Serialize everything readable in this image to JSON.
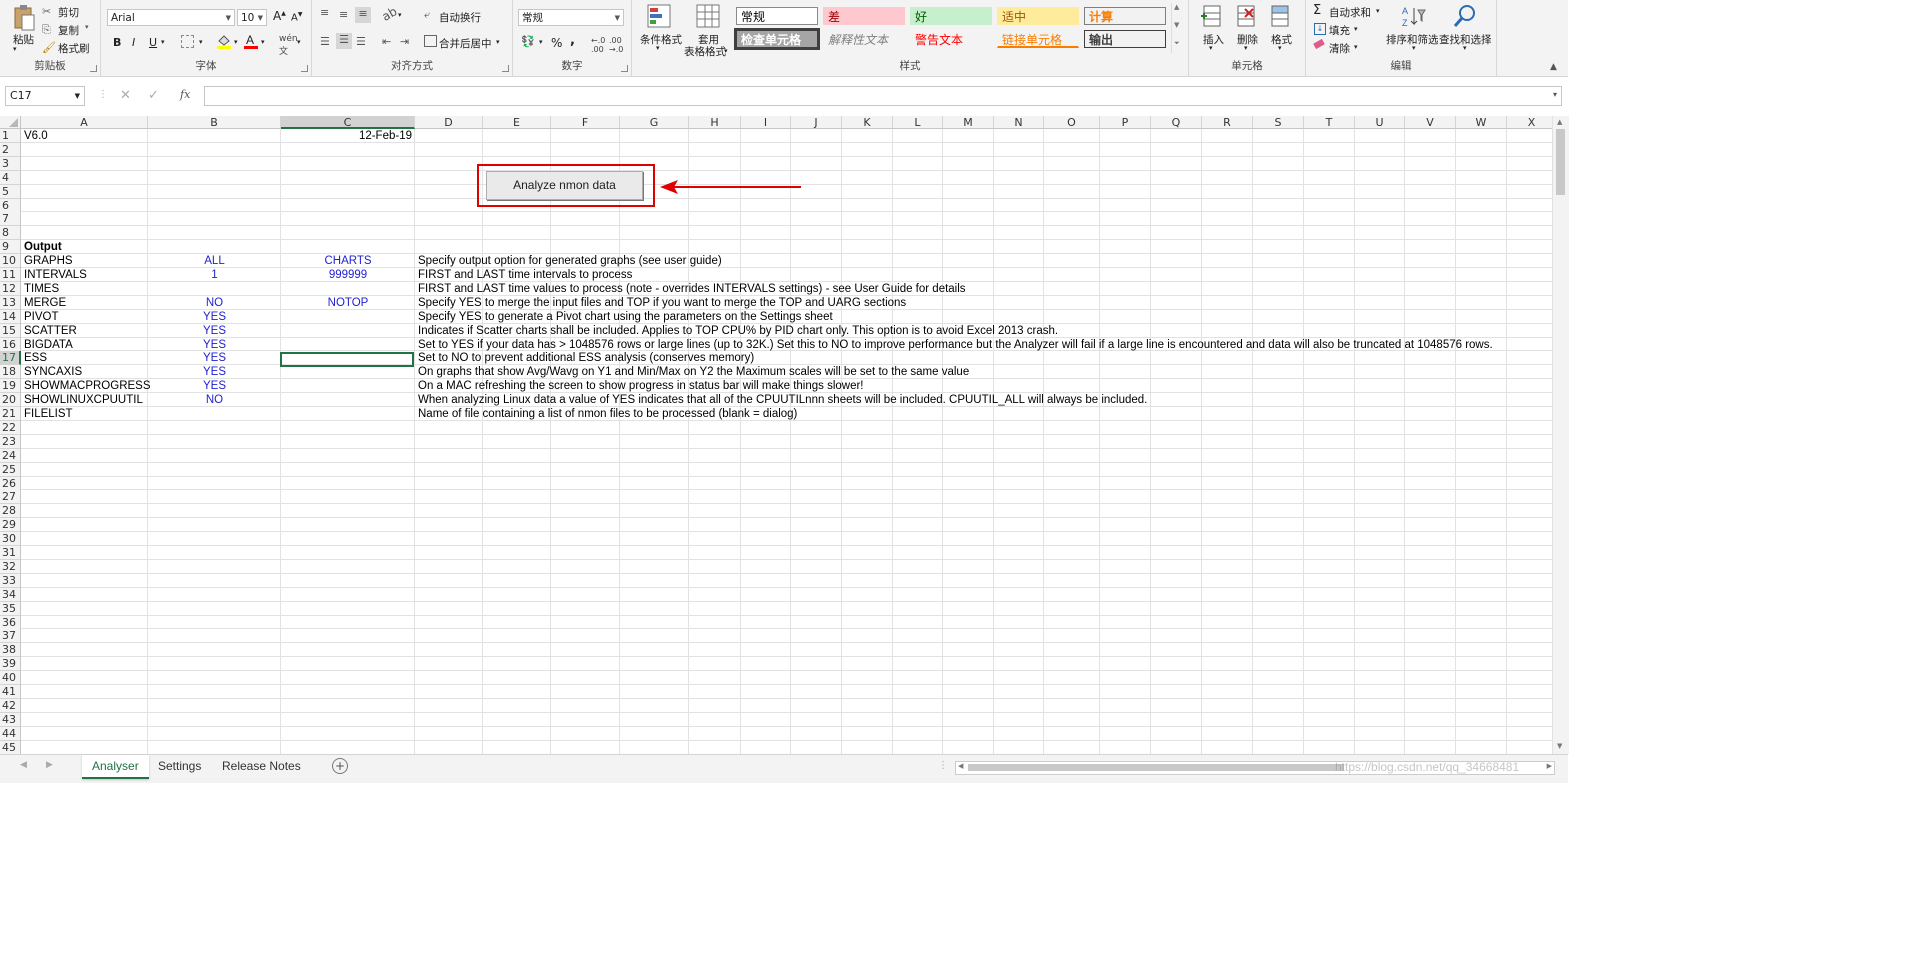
{
  "ribbon": {
    "clipboard": {
      "paste": "粘贴",
      "cut": "剪切",
      "copy": "复制",
      "format_painter": "格式刷",
      "group": "剪贴板"
    },
    "font": {
      "name": "Arial",
      "size": "10",
      "bold": "B",
      "italic": "I",
      "underline": "U",
      "group": "字体"
    },
    "alignment": {
      "wrap": "自动换行",
      "merge": "合并后居中",
      "group": "对齐方式"
    },
    "number": {
      "format": "常规",
      "percent": "%",
      "comma": ",",
      "group": "数字"
    },
    "styles": {
      "conditional": "条件格式",
      "table1": "套用",
      "table2": "表格格式",
      "cells": [
        {
          "label": "常规",
          "fg": "#000000",
          "bg": "#ffffff",
          "border": "#8a8a8a"
        },
        {
          "label": "差",
          "fg": "#9c0006",
          "bg": "#ffc7ce",
          "border": "#ffc7ce"
        },
        {
          "label": "好",
          "fg": "#006100",
          "bg": "#c6efce",
          "border": "#c6efce"
        },
        {
          "label": "适中",
          "fg": "#9c5700",
          "bg": "#ffeb9c",
          "border": "#ffeb9c"
        },
        {
          "label": "计算",
          "fg": "#fa7d00",
          "bg": "#f2f2f2",
          "border": "#7f7f7f"
        },
        {
          "label": "检查单元格",
          "fg": "#ffffff",
          "bg": "#a5a5a5",
          "border": "#3f3f3f"
        },
        {
          "label": "解释性文本",
          "fg": "#7f7f7f",
          "bg": "#f3f3f3",
          "border": "#f3f3f3"
        },
        {
          "label": "警告文本",
          "fg": "#ff0000",
          "bg": "#f3f3f3",
          "border": "#f3f3f3"
        },
        {
          "label": "链接单元格",
          "fg": "#fa7d00",
          "bg": "#f3f3f3",
          "border": "#f3f3f3"
        },
        {
          "label": "输出",
          "fg": "#3f3f3f",
          "bg": "#f2f2f2",
          "border": "#3f3f3f"
        }
      ],
      "group": "样式"
    },
    "cells": {
      "insert": "插入",
      "delete": "删除",
      "format": "格式",
      "group": "单元格"
    },
    "editing": {
      "autosum": "自动求和",
      "fill": "填充",
      "clear": "清除",
      "sort": "排序和筛选",
      "find": "查找和选择",
      "group": "编辑"
    }
  },
  "formula_bar": {
    "name_box": "C17",
    "fx": "fx",
    "content": ""
  },
  "columns": [
    "A",
    "B",
    "C",
    "D",
    "E",
    "F",
    "G",
    "H",
    "I",
    "J",
    "K",
    "L",
    "M",
    "N",
    "O",
    "P",
    "Q",
    "R",
    "S",
    "T",
    "U",
    "V",
    "W",
    "X"
  ],
  "rows_count": 45,
  "cells": {
    "a1": "V6.0",
    "c1": "12-Feb-19",
    "a9": "Output",
    "rows": [
      {
        "row": 10,
        "a": "GRAPHS",
        "b": "ALL",
        "c": "CHARTS",
        "d": "Specify output option for generated graphs (see user guide)"
      },
      {
        "row": 11,
        "a": "INTERVALS",
        "b": "1",
        "c": "999999",
        "d": "FIRST and LAST time intervals to process"
      },
      {
        "row": 12,
        "a": "TIMES",
        "b": "",
        "c": "",
        "d": "FIRST and LAST time values to process (note - overrides INTERVALS settings) - see User Guide for details"
      },
      {
        "row": 13,
        "a": "MERGE",
        "b": "NO",
        "c": "NOTOP",
        "d": "Specify YES to merge the input files and TOP if you want to merge the TOP and UARG sections"
      },
      {
        "row": 14,
        "a": "PIVOT",
        "b": "YES",
        "c": "",
        "d": "Specify YES to generate a Pivot chart using the parameters on the Settings sheet"
      },
      {
        "row": 15,
        "a": "SCATTER",
        "b": "YES",
        "c": "",
        "d": "Indicates if Scatter charts shall be included.  Applies to TOP CPU% by PID chart only.  This option is to avoid Excel 2013 crash."
      },
      {
        "row": 16,
        "a": "BIGDATA",
        "b": "YES",
        "c": "",
        "d": "Set to YES if your data has > 1048576 rows or large lines (up to 32K.)  Set this to NO to improve performance but the Analyzer will fail if a large line is encountered and data will also be truncated at 1048576 rows."
      },
      {
        "row": 17,
        "a": "ESS",
        "b": "YES",
        "c": "",
        "d": "Set to NO to prevent additional ESS analysis (conserves memory)"
      },
      {
        "row": 18,
        "a": "SYNCAXIS",
        "b": "YES",
        "c": "",
        "d": "On graphs that show Avg/Wavg on Y1 and Min/Max on Y2 the Maximum scales will be set to the same value"
      },
      {
        "row": 19,
        "a": "SHOWMACPROGRESS",
        "b": "YES",
        "c": "",
        "d": "On a MAC refreshing the screen to show progress in status bar will make things slower!"
      },
      {
        "row": 20,
        "a": "SHOWLINUXCPUUTIL",
        "b": "NO",
        "c": "",
        "d": "When analyzing Linux data a value of YES indicates that all of the CPUUTILnnn sheets will be included.  CPUUTIL_ALL will always be included."
      },
      {
        "row": 21,
        "a": "FILELIST",
        "b": "",
        "c": "",
        "d": "Name of file containing a list of nmon files to be processed (blank = dialog)"
      }
    ]
  },
  "analyze_button": "Analyze nmon data",
  "annotation_color": "#e00000",
  "sheet_tabs": [
    {
      "label": "Analyser",
      "active": true
    },
    {
      "label": "Settings",
      "active": false
    },
    {
      "label": "Release Notes",
      "active": false
    }
  ],
  "watermark": "https://blog.csdn.net/qq_34668481"
}
